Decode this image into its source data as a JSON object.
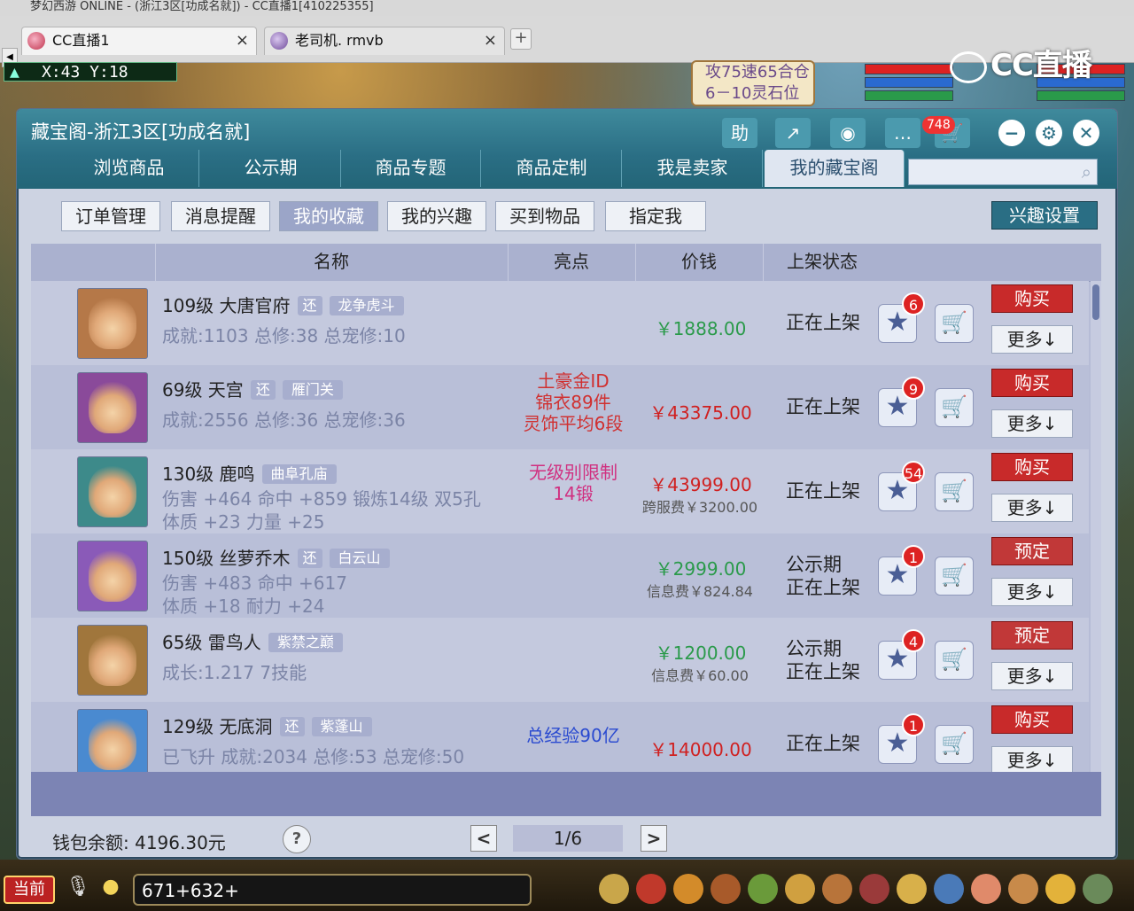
{
  "window": {
    "title_strip": "梦幻西游 ONLINE - (浙江3区[功成名就]) - CC直播1[410225355]"
  },
  "browser_tabs": [
    {
      "label": "CC直播1",
      "close": "×"
    },
    {
      "label": "老司机. rmvb",
      "close": "×"
    }
  ],
  "tab_add": "+",
  "game": {
    "coords": "X:43  Y:18",
    "quest_lines": [
      "攻75速65合仓",
      "6－10灵石位"
    ],
    "cc_logo": "CC直播",
    "chat_input": "671+632+",
    "current_channel": "当前"
  },
  "dialog": {
    "title": "藏宝阁-浙江3区[功成名就]",
    "header_icons": {
      "help": "助",
      "share": "↗",
      "record": "◉",
      "message": "…",
      "cart": "🛒"
    },
    "message_count": "748",
    "window_controls": {
      "minimize": "−",
      "settings": "⚙",
      "close": "✕"
    },
    "nav_tabs": [
      "浏览商品",
      "公示期",
      "商品专题",
      "商品定制",
      "我是卖家",
      "我的藏宝阁"
    ],
    "active_nav": 5,
    "search_placeholder": "",
    "sub_tabs": [
      "订单管理",
      "消息提醒",
      "我的收藏",
      "我的兴趣",
      "买到物品",
      "指定我"
    ],
    "active_sub": 2,
    "interest_settings": "兴趣设置",
    "columns": [
      "名称",
      "亮点",
      "价钱",
      "上架状态"
    ],
    "rows": [
      {
        "name": "109级  大唐官府",
        "tag": "还",
        "server": "龙争虎斗",
        "line2": "成就:1103  总修:38  总宠修:10",
        "line3": "",
        "highlights": [],
        "highlight_color": "#d03030",
        "price": "￥1888.00",
        "price_color": "#2a9a4a",
        "fee": "",
        "status": [
          "正在上架"
        ],
        "fav_count": "6",
        "action": "购买",
        "more": "更多↓",
        "avatar_color": "#b57848"
      },
      {
        "name": "69级  天宫",
        "tag": "还",
        "server": "雁门关",
        "line2": "成就:2556  总修:36  总宠修:36",
        "line3": "",
        "highlights": [
          "土豪金ID",
          "锦衣89件",
          "灵饰平均6段"
        ],
        "highlight_color": "#d03030",
        "price": "￥43375.00",
        "price_color": "#d02020",
        "fee": "",
        "status": [
          "正在上架"
        ],
        "fav_count": "9",
        "action": "购买",
        "more": "更多↓",
        "avatar_color": "#8a4a9a"
      },
      {
        "name": "130级  鹿鸣",
        "tag": "",
        "server": "曲阜孔庙",
        "line2": "伤害 +464  命中 +859  锻炼14级  双5孔",
        "line3": "体质 +23  力量 +25",
        "highlights": [
          "无级别限制",
          "14锻"
        ],
        "highlight_color": "#d03080",
        "price": "￥43999.00",
        "price_color": "#d02020",
        "fee": "跨服费￥3200.00",
        "status": [
          "正在上架"
        ],
        "fav_count": "54",
        "action": "购买",
        "more": "更多↓",
        "avatar_color": "#3d8a8a"
      },
      {
        "name": "150级  丝萝乔木",
        "tag": "还",
        "server": "白云山",
        "line2": "伤害 +483  命中 +617",
        "line3": "体质 +18  耐力 +24",
        "highlights": [],
        "highlight_color": "#d03030",
        "price": "￥2999.00",
        "price_color": "#2a9a4a",
        "fee": "信息费￥824.84",
        "status": [
          "公示期",
          "正在上架"
        ],
        "fav_count": "1",
        "action": "预定",
        "more": "更多↓",
        "avatar_color": "#8a5ab8"
      },
      {
        "name": "65级  雷鸟人",
        "tag": "",
        "server": "紫禁之巅",
        "line2": "成长:1.217  7技能",
        "line3": "",
        "highlights": [],
        "highlight_color": "#d03030",
        "price": "￥1200.00",
        "price_color": "#2a9a4a",
        "fee": "信息费￥60.00",
        "status": [
          "公示期",
          "正在上架"
        ],
        "fav_count": "4",
        "action": "预定",
        "more": "更多↓",
        "avatar_color": "#a0763c"
      },
      {
        "name": "129级  无底洞",
        "tag": "还",
        "server": "紫蓬山",
        "line2": "已飞升  成就:2034  总修:53  总宠修:50",
        "line3": "",
        "highlights": [
          "总经验90亿"
        ],
        "highlight_color": "#2a4ad0",
        "price": "￥14000.00",
        "price_color": "#d02020",
        "fee": "",
        "status": [
          "正在上架"
        ],
        "fav_count": "1",
        "action": "购买",
        "more": "更多↓",
        "avatar_color": "#4a8ad0"
      }
    ],
    "wallet": "钱包余额: 4196.30元",
    "help": "?",
    "page": "1/6",
    "prev": "<",
    "next": ">"
  }
}
